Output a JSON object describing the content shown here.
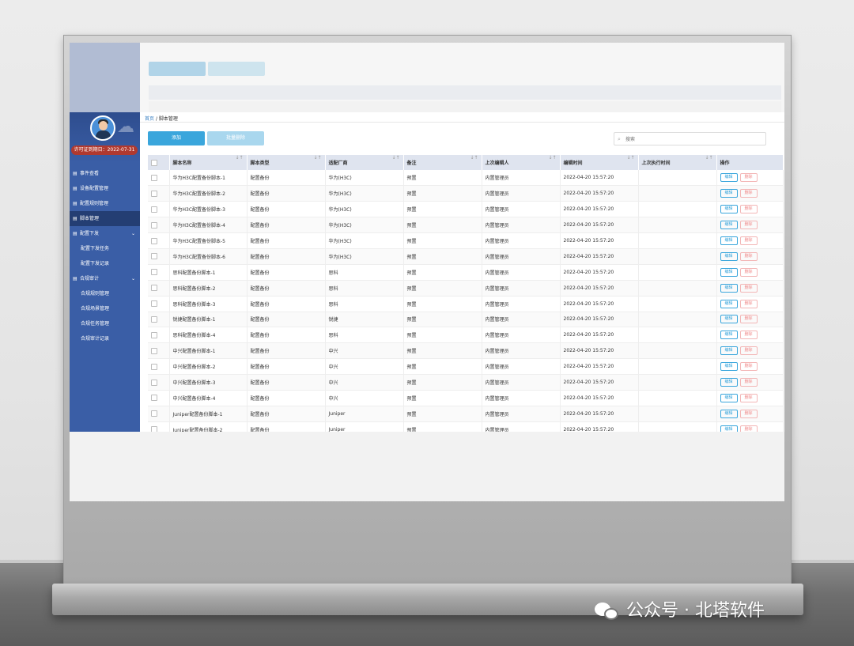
{
  "sidebar": {
    "license": "许可证到期日：2022-07-31",
    "items": [
      {
        "label": "事件查看",
        "icon": "list-icon",
        "active": false,
        "sub": false
      },
      {
        "label": "设备配置管理",
        "icon": "device-icon",
        "active": false,
        "sub": false
      },
      {
        "label": "配置规则管理",
        "icon": "rule-icon",
        "active": false,
        "sub": false
      },
      {
        "label": "脚本管理",
        "icon": "script-icon",
        "active": true,
        "sub": false
      },
      {
        "label": "配置下发",
        "icon": "send-icon",
        "active": false,
        "sub": false,
        "caret": "⌄"
      },
      {
        "label": "配置下发任务",
        "icon": "",
        "active": false,
        "sub": true
      },
      {
        "label": "配置下发记录",
        "icon": "",
        "active": false,
        "sub": true
      },
      {
        "label": "合规审计",
        "icon": "audit-icon",
        "active": false,
        "sub": false,
        "caret": "⌄"
      },
      {
        "label": "合规规则管理",
        "icon": "",
        "active": false,
        "sub": true
      },
      {
        "label": "合规场景管理",
        "icon": "",
        "active": false,
        "sub": true
      },
      {
        "label": "合规任务管理",
        "icon": "",
        "active": false,
        "sub": true
      },
      {
        "label": "合规审计记录",
        "icon": "",
        "active": false,
        "sub": true
      }
    ]
  },
  "breadcrumb": {
    "home": "首页",
    "sep": "/",
    "current": "脚本管理"
  },
  "toolbar": {
    "add_label": "添加",
    "batch_delete_label": "批量删除",
    "search_placeholder": "搜索"
  },
  "table": {
    "columns": [
      "脚本名称",
      "脚本类型",
      "适配厂商",
      "备注",
      "上次编辑人",
      "编辑时间",
      "上次执行时间",
      "操作"
    ],
    "sort_glyph": "↓↑",
    "edit_label": "编辑",
    "delete_label": "删除",
    "rows": [
      [
        "华为H3C配置备份脚本-1",
        "配置备份",
        "华为(H3C)",
        "预置",
        "内置管理员",
        "2022-04-20 15:57:20",
        ""
      ],
      [
        "华为H3C配置备份脚本-2",
        "配置备份",
        "华为(H3C)",
        "预置",
        "内置管理员",
        "2022-04-20 15:57:20",
        ""
      ],
      [
        "华为H3C配置备份脚本-3",
        "配置备份",
        "华为(H3C)",
        "预置",
        "内置管理员",
        "2022-04-20 15:57:20",
        ""
      ],
      [
        "华为H3C配置备份脚本-4",
        "配置备份",
        "华为(H3C)",
        "预置",
        "内置管理员",
        "2022-04-20 15:57:20",
        ""
      ],
      [
        "华为H3C配置备份脚本-5",
        "配置备份",
        "华为(H3C)",
        "预置",
        "内置管理员",
        "2022-04-20 15:57:20",
        ""
      ],
      [
        "华为H3C配置备份脚本-6",
        "配置备份",
        "华为(H3C)",
        "预置",
        "内置管理员",
        "2022-04-20 15:57:20",
        ""
      ],
      [
        "思科配置备份脚本-1",
        "配置备份",
        "思科",
        "预置",
        "内置管理员",
        "2022-04-20 15:57:20",
        ""
      ],
      [
        "思科配置备份脚本-2",
        "配置备份",
        "思科",
        "预置",
        "内置管理员",
        "2022-04-20 15:57:20",
        ""
      ],
      [
        "思科配置备份脚本-3",
        "配置备份",
        "思科",
        "预置",
        "内置管理员",
        "2022-04-20 15:57:20",
        ""
      ],
      [
        "锐捷配置备份脚本-1",
        "配置备份",
        "锐捷",
        "预置",
        "内置管理员",
        "2022-04-20 15:57:20",
        ""
      ],
      [
        "思科配置备份脚本-4",
        "配置备份",
        "思科",
        "预置",
        "内置管理员",
        "2022-04-20 15:57:20",
        ""
      ],
      [
        "中兴配置备份脚本-1",
        "配置备份",
        "中兴",
        "预置",
        "内置管理员",
        "2022-04-20 15:57:20",
        ""
      ],
      [
        "中兴配置备份脚本-2",
        "配置备份",
        "中兴",
        "预置",
        "内置管理员",
        "2022-04-20 15:57:20",
        ""
      ],
      [
        "中兴配置备份脚本-3",
        "配置备份",
        "中兴",
        "预置",
        "内置管理员",
        "2022-04-20 15:57:20",
        ""
      ],
      [
        "中兴配置备份脚本-4",
        "配置备份",
        "中兴",
        "预置",
        "内置管理员",
        "2022-04-20 15:57:20",
        ""
      ],
      [
        "Juniper配置备份脚本-1",
        "配置备份",
        "Juniper",
        "预置",
        "内置管理员",
        "2022-04-20 15:57:20",
        ""
      ],
      [
        "Juniper配置备份脚本-2",
        "配置备份",
        "Juniper",
        "预置",
        "内置管理员",
        "2022-04-20 15:57:20",
        ""
      ]
    ]
  },
  "watermark": "公众号 · 北塔软件",
  "colors": {
    "sidebar": "#3a5ea6",
    "primary": "#3aa6dc",
    "danger": "#f08a8a",
    "header_row": "#dfe4ef"
  }
}
